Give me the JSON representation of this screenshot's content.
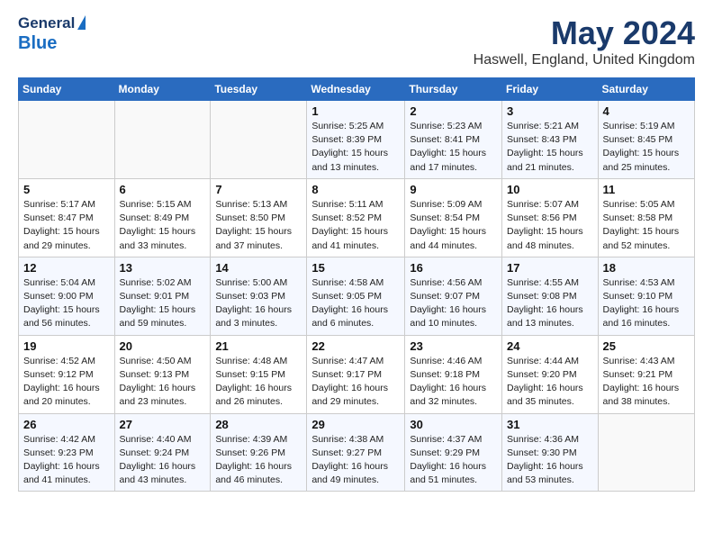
{
  "header": {
    "logo_general": "General",
    "logo_blue": "Blue",
    "title": "May 2024",
    "location": "Haswell, England, United Kingdom"
  },
  "days_of_week": [
    "Sunday",
    "Monday",
    "Tuesday",
    "Wednesday",
    "Thursday",
    "Friday",
    "Saturday"
  ],
  "weeks": [
    [
      {
        "day": "",
        "info": ""
      },
      {
        "day": "",
        "info": ""
      },
      {
        "day": "",
        "info": ""
      },
      {
        "day": "1",
        "info": "Sunrise: 5:25 AM\nSunset: 8:39 PM\nDaylight: 15 hours\nand 13 minutes."
      },
      {
        "day": "2",
        "info": "Sunrise: 5:23 AM\nSunset: 8:41 PM\nDaylight: 15 hours\nand 17 minutes."
      },
      {
        "day": "3",
        "info": "Sunrise: 5:21 AM\nSunset: 8:43 PM\nDaylight: 15 hours\nand 21 minutes."
      },
      {
        "day": "4",
        "info": "Sunrise: 5:19 AM\nSunset: 8:45 PM\nDaylight: 15 hours\nand 25 minutes."
      }
    ],
    [
      {
        "day": "5",
        "info": "Sunrise: 5:17 AM\nSunset: 8:47 PM\nDaylight: 15 hours\nand 29 minutes."
      },
      {
        "day": "6",
        "info": "Sunrise: 5:15 AM\nSunset: 8:49 PM\nDaylight: 15 hours\nand 33 minutes."
      },
      {
        "day": "7",
        "info": "Sunrise: 5:13 AM\nSunset: 8:50 PM\nDaylight: 15 hours\nand 37 minutes."
      },
      {
        "day": "8",
        "info": "Sunrise: 5:11 AM\nSunset: 8:52 PM\nDaylight: 15 hours\nand 41 minutes."
      },
      {
        "day": "9",
        "info": "Sunrise: 5:09 AM\nSunset: 8:54 PM\nDaylight: 15 hours\nand 44 minutes."
      },
      {
        "day": "10",
        "info": "Sunrise: 5:07 AM\nSunset: 8:56 PM\nDaylight: 15 hours\nand 48 minutes."
      },
      {
        "day": "11",
        "info": "Sunrise: 5:05 AM\nSunset: 8:58 PM\nDaylight: 15 hours\nand 52 minutes."
      }
    ],
    [
      {
        "day": "12",
        "info": "Sunrise: 5:04 AM\nSunset: 9:00 PM\nDaylight: 15 hours\nand 56 minutes."
      },
      {
        "day": "13",
        "info": "Sunrise: 5:02 AM\nSunset: 9:01 PM\nDaylight: 15 hours\nand 59 minutes."
      },
      {
        "day": "14",
        "info": "Sunrise: 5:00 AM\nSunset: 9:03 PM\nDaylight: 16 hours\nand 3 minutes."
      },
      {
        "day": "15",
        "info": "Sunrise: 4:58 AM\nSunset: 9:05 PM\nDaylight: 16 hours\nand 6 minutes."
      },
      {
        "day": "16",
        "info": "Sunrise: 4:56 AM\nSunset: 9:07 PM\nDaylight: 16 hours\nand 10 minutes."
      },
      {
        "day": "17",
        "info": "Sunrise: 4:55 AM\nSunset: 9:08 PM\nDaylight: 16 hours\nand 13 minutes."
      },
      {
        "day": "18",
        "info": "Sunrise: 4:53 AM\nSunset: 9:10 PM\nDaylight: 16 hours\nand 16 minutes."
      }
    ],
    [
      {
        "day": "19",
        "info": "Sunrise: 4:52 AM\nSunset: 9:12 PM\nDaylight: 16 hours\nand 20 minutes."
      },
      {
        "day": "20",
        "info": "Sunrise: 4:50 AM\nSunset: 9:13 PM\nDaylight: 16 hours\nand 23 minutes."
      },
      {
        "day": "21",
        "info": "Sunrise: 4:48 AM\nSunset: 9:15 PM\nDaylight: 16 hours\nand 26 minutes."
      },
      {
        "day": "22",
        "info": "Sunrise: 4:47 AM\nSunset: 9:17 PM\nDaylight: 16 hours\nand 29 minutes."
      },
      {
        "day": "23",
        "info": "Sunrise: 4:46 AM\nSunset: 9:18 PM\nDaylight: 16 hours\nand 32 minutes."
      },
      {
        "day": "24",
        "info": "Sunrise: 4:44 AM\nSunset: 9:20 PM\nDaylight: 16 hours\nand 35 minutes."
      },
      {
        "day": "25",
        "info": "Sunrise: 4:43 AM\nSunset: 9:21 PM\nDaylight: 16 hours\nand 38 minutes."
      }
    ],
    [
      {
        "day": "26",
        "info": "Sunrise: 4:42 AM\nSunset: 9:23 PM\nDaylight: 16 hours\nand 41 minutes."
      },
      {
        "day": "27",
        "info": "Sunrise: 4:40 AM\nSunset: 9:24 PM\nDaylight: 16 hours\nand 43 minutes."
      },
      {
        "day": "28",
        "info": "Sunrise: 4:39 AM\nSunset: 9:26 PM\nDaylight: 16 hours\nand 46 minutes."
      },
      {
        "day": "29",
        "info": "Sunrise: 4:38 AM\nSunset: 9:27 PM\nDaylight: 16 hours\nand 49 minutes."
      },
      {
        "day": "30",
        "info": "Sunrise: 4:37 AM\nSunset: 9:29 PM\nDaylight: 16 hours\nand 51 minutes."
      },
      {
        "day": "31",
        "info": "Sunrise: 4:36 AM\nSunset: 9:30 PM\nDaylight: 16 hours\nand 53 minutes."
      },
      {
        "day": "",
        "info": ""
      }
    ]
  ]
}
